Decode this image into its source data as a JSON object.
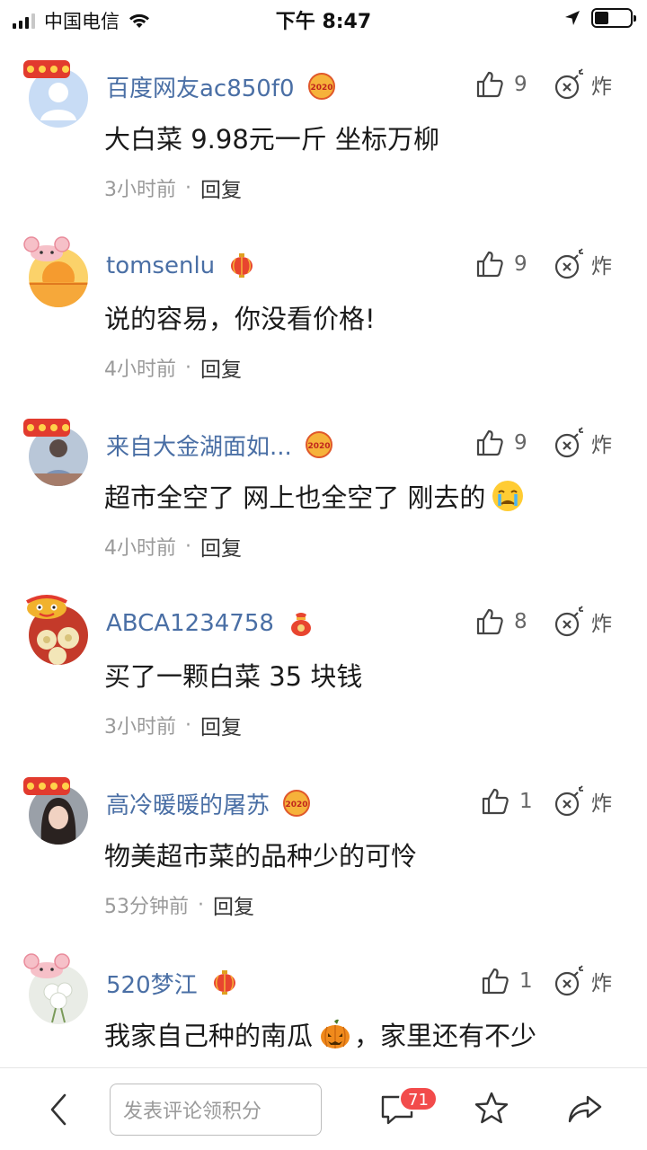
{
  "status_bar": {
    "carrier": "中国电信",
    "time": "下午 8:47"
  },
  "comments": [
    {
      "username": "百度网友ac850f0",
      "text": "大白菜 9.98元一斤  坐标万柳",
      "time": "3小时前",
      "reply": "回复",
      "likes": "9",
      "bomb": "炸",
      "badge": "2020",
      "pendant": "鼠年大吉"
    },
    {
      "username": "tomsenlu",
      "text": "说的容易，你没看价格!",
      "time": "4小时前",
      "reply": "回复",
      "likes": "9",
      "bomb": "炸"
    },
    {
      "username": "来自大金湖面如...",
      "text": "超市全空了 网上也全空了 刚去的",
      "time": "4小时前",
      "reply": "回复",
      "likes": "9",
      "bomb": "炸",
      "badge": "2020",
      "pendant": "鼠年大吉"
    },
    {
      "username": "ABCA1234758",
      "text": "买了一颗白菜 35 块钱",
      "time": "3小时前",
      "reply": "回复",
      "likes": "8",
      "bomb": "炸"
    },
    {
      "username": "高冷暖暖的屠苏",
      "text": "物美超市菜的品种少的可怜",
      "time": "53分钟前",
      "reply": "回复",
      "likes": "1",
      "bomb": "炸",
      "badge": "2020",
      "pendant": "鼠年大吉"
    },
    {
      "username": "520梦江",
      "text": "我家自己种的南瓜",
      "text_after": "，家里还有不少",
      "time": "",
      "reply": "",
      "likes": "1",
      "bomb": "炸"
    }
  ],
  "bottom_bar": {
    "input_placeholder": "发表评论领积分",
    "comment_count": "71"
  },
  "icons": {
    "back": "chevron-left-icon",
    "comment": "comment-icon",
    "star": "star-icon",
    "share": "share-icon",
    "like": "thumbs-up-icon",
    "bomb": "bomb-icon"
  },
  "colors": {
    "username": "#4a6fa5",
    "badge_red": "#f24b4b",
    "meta": "#9a9a9a"
  }
}
